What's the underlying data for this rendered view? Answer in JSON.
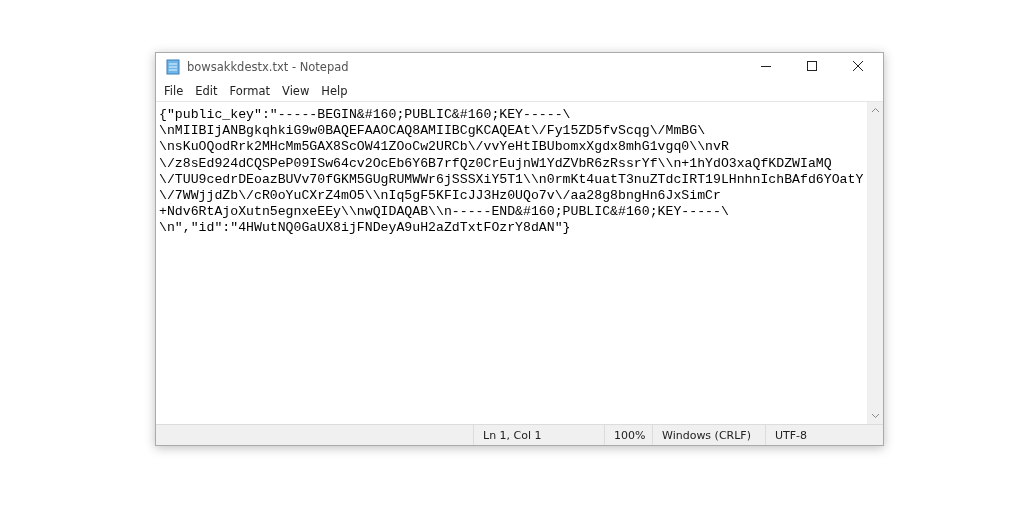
{
  "window": {
    "title": "bowsakkdestx.txt - Notepad"
  },
  "menu": [
    {
      "label": "File"
    },
    {
      "label": "Edit"
    },
    {
      "label": "Format"
    },
    {
      "label": "View"
    },
    {
      "label": "Help"
    }
  ],
  "editor": {
    "lines": [
      "{\"public_key\":\"-----BEGIN&#160;PUBLIC&#160;KEY-----\\",
      "\\nMIIBIjANBgkqhkiG9w0BAQEFAAOCAQ8AMIIBCgKCAQEAt\\/Fy15ZD5fvScqg\\/MmBG\\",
      "\\nsKuOQodRrk2MHcMm5GAX8ScOW41ZOoCw2URCb\\/vvYeHtIBUbomxXgdx8mhG1vgq0\\\\nvR",
      "\\/z8sEd924dCQSPeP09ISw64cv2OcEb6Y6B7rfQz0CrEujnW1YdZVbR6zRssrYf\\\\n+1hYdO3xaQfKDZWIaMQ",
      "\\/TUU9cedrDEoazBUVv70fGKM5GUgRUMWWr6jSSSXiY5T1\\\\n0rmKt4uatT3nuZTdcIRT19LHnhnIchBAfd6YOatY",
      "\\/7WWjjdZb\\/cR0oYuCXrZ4mO5\\\\nIq5gF5KFIcJJ3Hz0UQo7v\\/aa28g8bngHn6JxSimCr",
      "+Ndv6RtAjoXutn5egnxeEEy\\\\nwQIDAQAB\\\\n-----END&#160;PUBLIC&#160;KEY-----\\",
      "\\n\",\"id\":\"4HWutNQ0GaUX8ijFNDeyA9uH2aZdTxtFOzrY8dAN\"}"
    ]
  },
  "status_bar": {
    "position": "Ln 1, Col 1",
    "zoom": "100%",
    "line_endings": "Windows (CRLF)",
    "encoding": "UTF-8"
  }
}
